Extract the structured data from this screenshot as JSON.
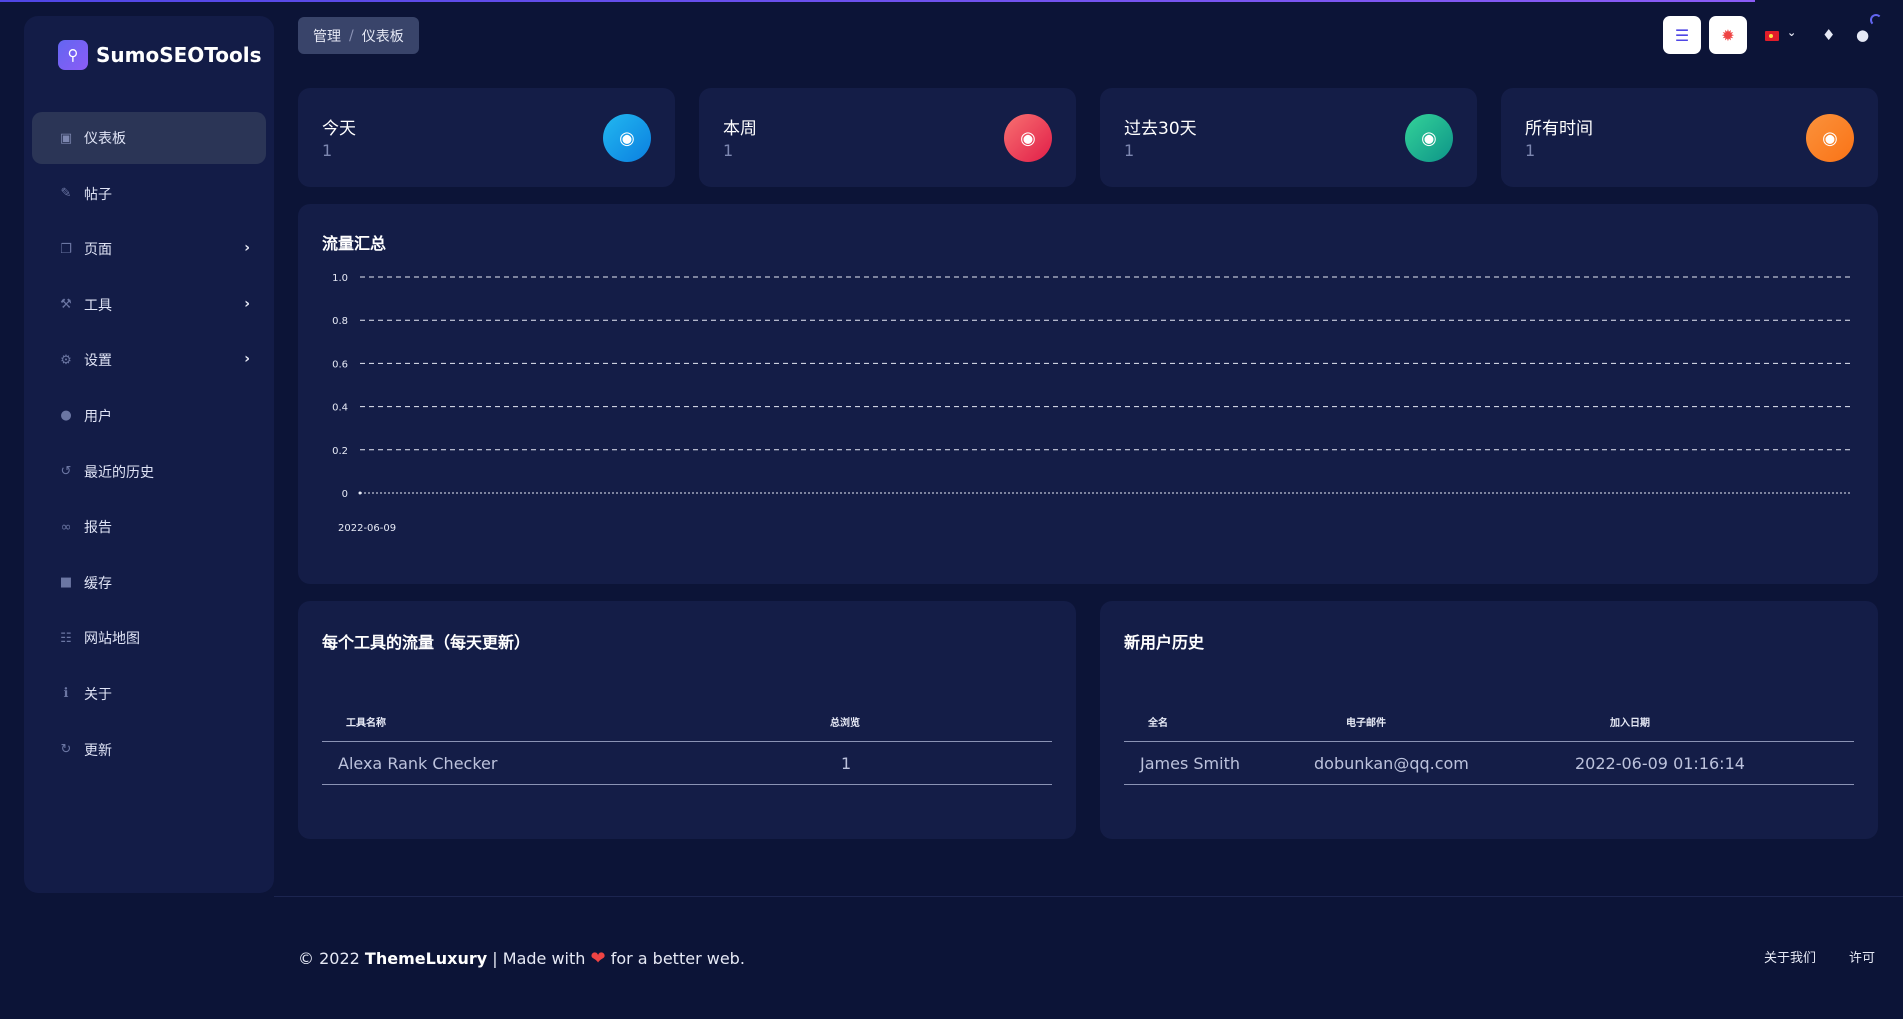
{
  "brand": {
    "name": "SumoSEOTools",
    "logo_icon": "magnifier-chart-icon"
  },
  "sidebar": {
    "items": [
      {
        "label": "仪表板",
        "icon": "dashboard-icon",
        "active": true
      },
      {
        "label": "帖子",
        "icon": "pencil-icon"
      },
      {
        "label": "页面",
        "icon": "pages-icon",
        "has_submenu": true
      },
      {
        "label": "工具",
        "icon": "tools-icon",
        "has_submenu": true
      },
      {
        "label": "设置",
        "icon": "gears-icon",
        "has_submenu": true
      },
      {
        "label": "用户",
        "icon": "users-icon"
      },
      {
        "label": "最近的历史",
        "icon": "history-icon"
      },
      {
        "label": "报告",
        "icon": "link-icon"
      },
      {
        "label": "缓存",
        "icon": "archive-icon"
      },
      {
        "label": "网站地图",
        "icon": "sitemap-icon"
      },
      {
        "label": "关于",
        "icon": "info-icon"
      },
      {
        "label": "更新",
        "icon": "refresh-icon"
      }
    ]
  },
  "breadcrumb": {
    "parent": "管理",
    "separator": "/",
    "current": "仪表板"
  },
  "header": {
    "menu_icon": "menu-icon",
    "bug_icon": "bug-icon",
    "language_flag": "china-flag-icon",
    "bell_icon": "bell-icon",
    "user_icon": "user-icon"
  },
  "stats": [
    {
      "title": "今天",
      "value": "1",
      "color": "#0ea5e9",
      "icon": "globe-icon"
    },
    {
      "title": "本周",
      "value": "1",
      "color": "#ef4444",
      "icon": "globe-icon"
    },
    {
      "title": "过去30天",
      "value": "1",
      "color": "#10b981",
      "icon": "globe-icon"
    },
    {
      "title": "所有时间",
      "value": "1",
      "color": "#f97316",
      "icon": "globe-icon"
    }
  ],
  "traffic_chart": {
    "title": "流量汇总"
  },
  "chart_data": {
    "type": "line",
    "title": "流量汇总",
    "x": [
      "2022-06-09"
    ],
    "series": [
      {
        "values": [
          0
        ]
      }
    ],
    "ylim": [
      0,
      1.0
    ],
    "yticks": [
      "0",
      "0.2",
      "0.4",
      "0.6",
      "0.8",
      "1.0"
    ],
    "grid": true
  },
  "tools_table": {
    "title": "每个工具的流量（每天更新）",
    "headers": [
      "工具名称",
      "总浏览"
    ],
    "rows": [
      [
        "Alexa Rank Checker",
        "1"
      ]
    ]
  },
  "users_table": {
    "title": "新用户历史",
    "headers": [
      "全名",
      "电子邮件",
      "加入日期"
    ],
    "rows": [
      [
        "James Smith",
        "dobunkan@qq.com",
        "2022-06-09 01:16:14"
      ]
    ]
  },
  "footer": {
    "copyright": "© 2022",
    "company": "ThemeLuxury",
    "made_with": "| Made with",
    "tail": "for a better web.",
    "heart_icon": "heart-icon",
    "links": [
      "关于我们",
      "许可"
    ]
  }
}
